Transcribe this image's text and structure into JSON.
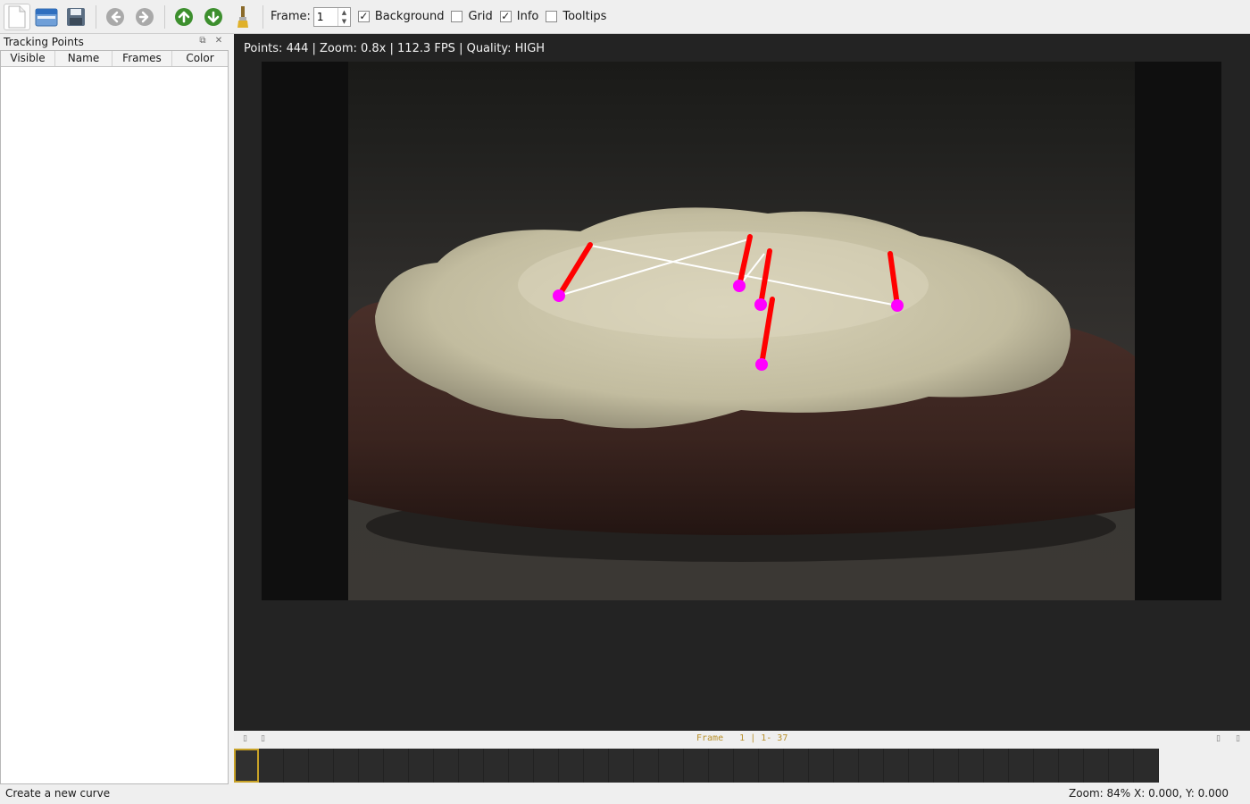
{
  "toolbar": {
    "buttons": [
      {
        "icon": "new-file-icon",
        "active": true
      },
      {
        "icon": "open-file-icon"
      },
      {
        "icon": "save-icon"
      },
      {
        "icon": "back-icon"
      },
      {
        "icon": "forward-icon"
      },
      {
        "icon": "up-icon"
      },
      {
        "icon": "down-icon"
      },
      {
        "icon": "brush-icon"
      }
    ],
    "frame_label": "Frame:",
    "frame_value": "1",
    "checks": [
      {
        "label": "Background",
        "checked": true
      },
      {
        "label": "Grid",
        "checked": false
      },
      {
        "label": "Info",
        "checked": true
      },
      {
        "label": "Tooltips",
        "checked": false
      }
    ]
  },
  "dock": {
    "title": "Tracking Points",
    "columns": [
      "Visible",
      "Name",
      "Frames",
      "Color"
    ]
  },
  "viewport": {
    "info": "Points: 444 | Zoom: 0.8x | 112.3 FPS | Quality: HIGH",
    "tracking_points_color": "#ff00ff",
    "trail_color": "#ff0000",
    "line_color": "#ffffff"
  },
  "timeline": {
    "label": "Frame   1 | 1- 37",
    "total_frames": 37,
    "current_frame": 1,
    "current_color": "#c8a227"
  },
  "status": {
    "message": "Create a new curve",
    "zoom": "Zoom: 84%  X: 0.000, Y: 0.000"
  }
}
